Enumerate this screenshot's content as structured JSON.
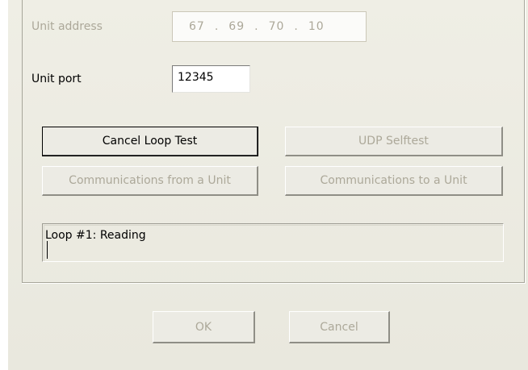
{
  "form": {
    "unit_address_label": "Unit address",
    "unit_address_octets": [
      "67",
      "69",
      "70",
      "10"
    ],
    "unit_port_label": "Unit port",
    "unit_port_value": "12345"
  },
  "buttons": {
    "cancel_loop_test": "Cancel Loop Test",
    "udp_selftest": "UDP Selftest",
    "comm_from_unit": "Communications from a Unit",
    "comm_to_unit": "Communications to a Unit",
    "ok": "OK",
    "cancel": "Cancel"
  },
  "status": {
    "text": "Loop #1: Reading"
  },
  "colors": {
    "dialog_bg": "#ece9d8",
    "disabled_text": "#aca899"
  }
}
